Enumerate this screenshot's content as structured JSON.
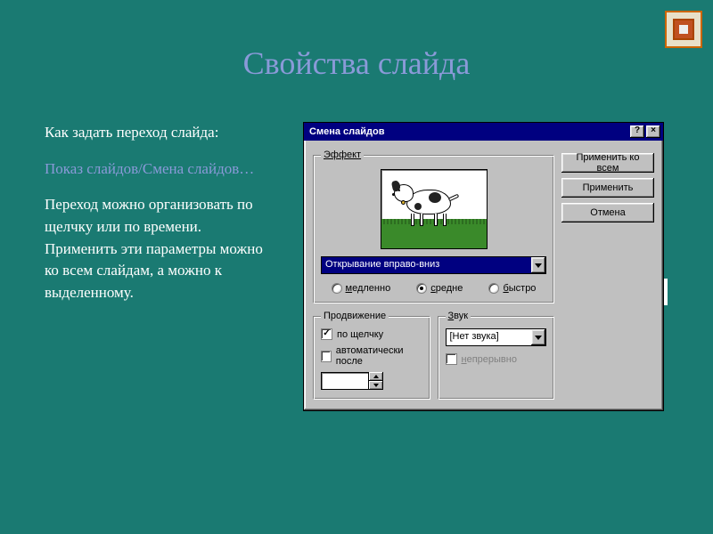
{
  "slide": {
    "title": "Свойства слайда",
    "heading": "Как задать переход слайда:",
    "path": "Показ слайдов/Смена слайдов…",
    "desc": "Переход можно организовать по щелчку или по времени. Применить эти параметры можно ко всем слайдам, а можно к выделенному."
  },
  "dialog": {
    "title": "Смена слайдов",
    "help": "?",
    "close": "×",
    "effect": {
      "legend": "Эффект",
      "selected": "Открывание вправо-вниз",
      "speed": {
        "slow": "медленно",
        "medium": "средне",
        "fast": "быстро",
        "selected": "medium"
      }
    },
    "advance": {
      "legend": "Продвижение",
      "onclick": "по щелчку",
      "auto": "автоматически после",
      "onclick_checked": true,
      "auto_checked": false
    },
    "sound": {
      "legend": "Звук",
      "selected": "[Нет звука]",
      "loop": "непрерывно",
      "loop_checked": false
    },
    "buttons": {
      "apply_all": "Применить ко всем",
      "apply": "Применить",
      "cancel": "Отмена"
    }
  }
}
